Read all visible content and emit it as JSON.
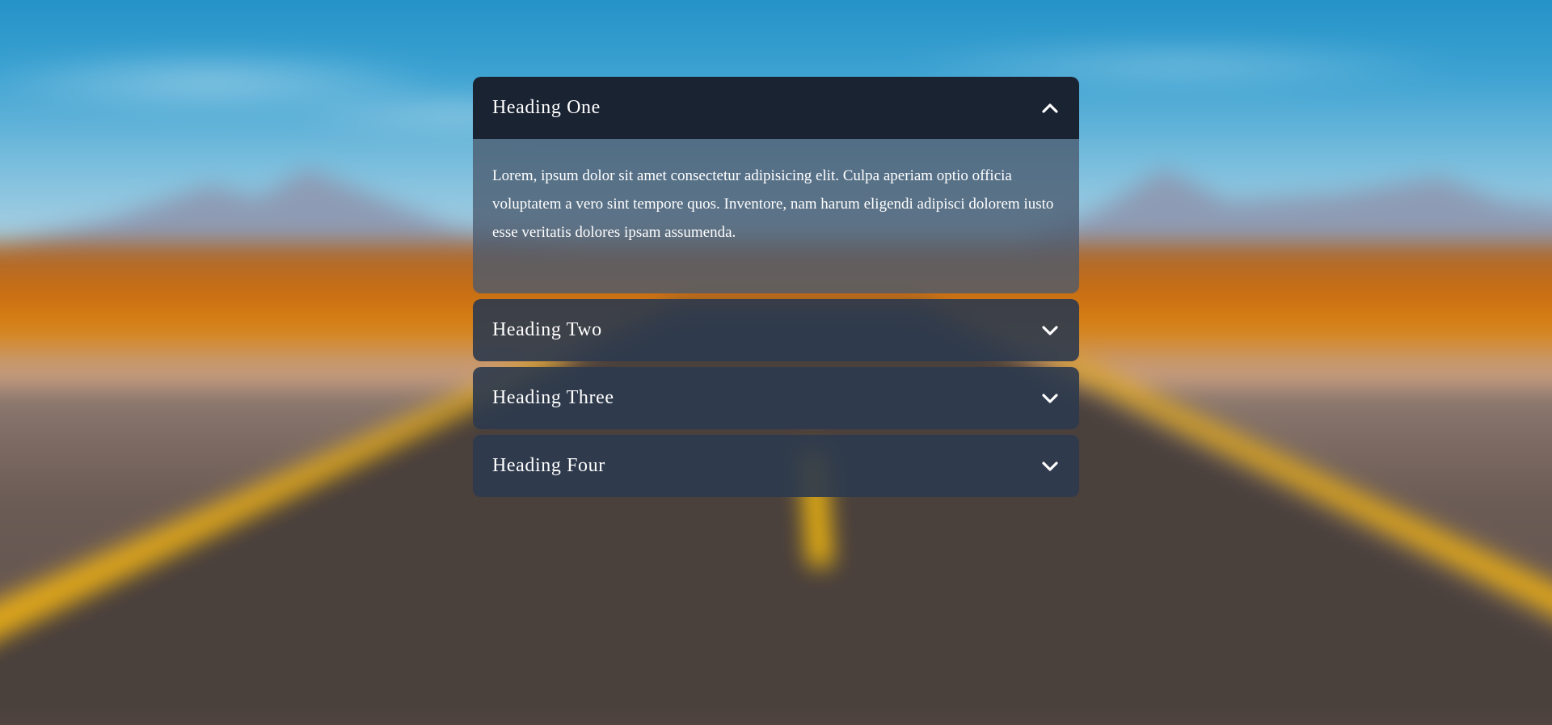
{
  "accordion": {
    "items": [
      {
        "heading": "Heading One",
        "expanded": true,
        "icon": "chevron-up-icon",
        "content": "Lorem, ipsum dolor sit amet consectetur adipisicing elit. Culpa aperiam optio officia voluptatem a vero sint tempore quos. Inventore, nam harum eligendi adipisci dolorem iusto esse veritatis dolores ipsam assumenda."
      },
      {
        "heading": "Heading Two",
        "expanded": false,
        "icon": "chevron-down-icon"
      },
      {
        "heading": "Heading Three",
        "expanded": false,
        "icon": "chevron-down-icon"
      },
      {
        "heading": "Heading Four",
        "expanded": false,
        "icon": "chevron-down-icon"
      }
    ]
  },
  "colors": {
    "header_open": "#1a2332",
    "header_closed": "#2c3a4e",
    "text": "#ffffff"
  }
}
